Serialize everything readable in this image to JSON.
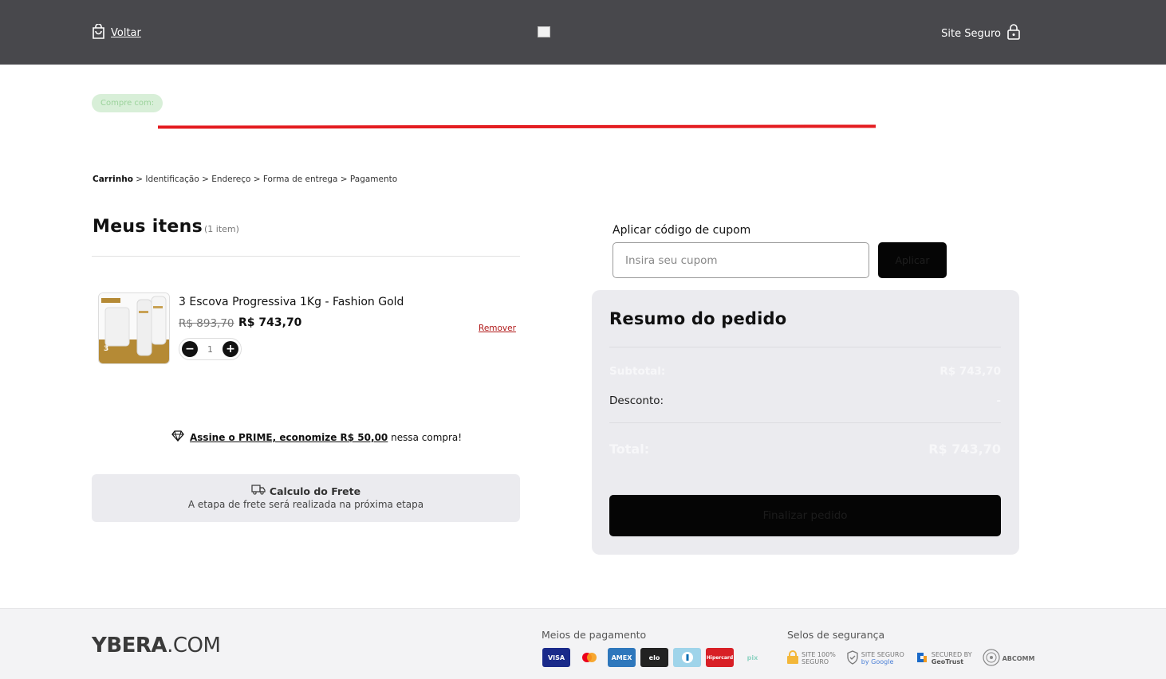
{
  "header": {
    "back_label": "Voltar",
    "secure_label": "Site Seguro"
  },
  "promo": {
    "buy_with_label": "Compre com:"
  },
  "breadcrumb": {
    "current": "Carrinho",
    "rest": " > Identificação > Endereço > Forma de entrega > Pagamento"
  },
  "cart": {
    "title": "Meus itens",
    "count": "(1 item)",
    "items": [
      {
        "name": "3 Escova Progressiva 1Kg - Fashion Gold",
        "price_old": "R$ 893,70",
        "price_new": "R$ 743,70",
        "quantity": "1",
        "remove_label": "Remover",
        "image_label": "3"
      }
    ],
    "prime_link": "Assine o PRIME, economize R$ 50,00",
    "prime_suffix": " nessa compra!",
    "freight_title": "Calculo do Frete",
    "freight_sub": "A etapa de frete será realizada na próxima etapa"
  },
  "coupon": {
    "label": "Aplicar código de cupom",
    "placeholder": "Insira seu cupom",
    "button": "Aplicar"
  },
  "summary": {
    "title": "Resumo do pedido",
    "subtotal_label": "Subtotal:",
    "subtotal_value": "R$ 743,70",
    "discount_label": "Desconto:",
    "discount_value": "-",
    "total_label": "Total:",
    "total_value": "R$ 743,70",
    "checkout_label": "Finalizar pedido"
  },
  "footer": {
    "brand_bold": "YBERA",
    "brand_rest": ".COM",
    "payment_title": "Meios de pagamento",
    "payment_methods": [
      "VISA",
      "",
      "AMEX",
      "elo",
      "",
      "Hipercard",
      "pix"
    ],
    "security_title": "Selos de segurança",
    "seals": [
      {
        "line1": "SITE 100%",
        "line2": "SEGURO"
      },
      {
        "line1": "SITE SEGURO",
        "line2": "by Google"
      },
      {
        "line1": "SECURED BY",
        "line2": "GeoTrust"
      },
      {
        "line1": "ABCOMM",
        "line2": ""
      }
    ]
  },
  "colors": {
    "topbar": "#48484c",
    "accent_line": "#e41e22",
    "summary_bg": "#ebebef",
    "button_bg": "#050505",
    "remove_link": "#b01818"
  }
}
